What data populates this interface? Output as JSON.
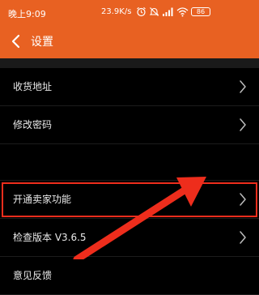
{
  "status_bar": {
    "time": "晚上9:09",
    "network_speed": "23.9K/s",
    "battery_level": "86",
    "icons": [
      "alarm-icon",
      "mute-icon",
      "signal-icon",
      "wifi-icon",
      "battery-icon"
    ]
  },
  "header": {
    "title": "设置",
    "back_icon": "chevron-left-icon"
  },
  "menu": {
    "items": [
      {
        "label": "收货地址",
        "highlighted": false
      },
      {
        "label": "修改密码",
        "highlighted": false
      },
      {
        "label": "开通卖家功能",
        "highlighted": true
      },
      {
        "label": "检查版本 V3.6.5",
        "highlighted": false
      },
      {
        "label": "意见反馈",
        "highlighted": false
      }
    ]
  },
  "colors": {
    "header_background": "#e86122",
    "page_background": "#000000",
    "highlight_box": "#ee2d1c",
    "annotation_arrow": "#ee2d1c"
  }
}
